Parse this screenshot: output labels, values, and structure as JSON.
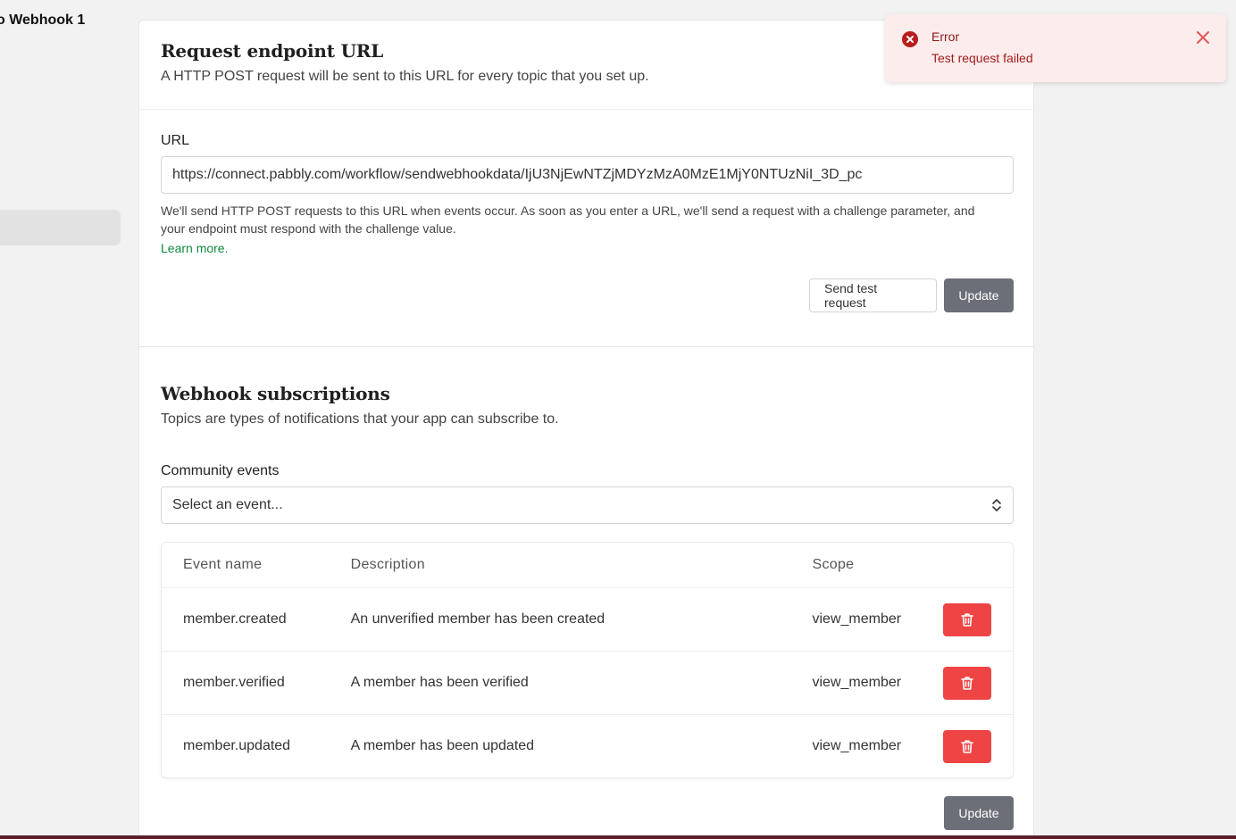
{
  "page_title": "o Webhook 1",
  "endpoint": {
    "heading": "Request endpoint URL",
    "subtitle": "A HTTP POST request will be sent to this URL for every topic that you set up.",
    "url_label": "URL",
    "url_value": "https://connect.pabbly.com/workflow/sendwebhookdata/IjU3NjEwNTZjMDYzMzA0MzE1MjY0NTUzNiI_3D_pc",
    "help_text": "We'll send HTTP POST requests to this URL when events occur. As soon as you enter a URL, we'll send a request with a challenge parameter, and your endpoint must respond with the challenge value.",
    "learn_more": "Learn more.",
    "send_test_label": "Send test request",
    "update_label": "Update"
  },
  "subscriptions": {
    "heading": "Webhook subscriptions",
    "subtitle": "Topics are types of notifications that your app can subscribe to.",
    "select_label": "Community events",
    "select_placeholder": "Select an event...",
    "columns": [
      "Event name",
      "Description",
      "Scope"
    ],
    "rows": [
      {
        "event": "member.created",
        "description": "An unverified member has been created",
        "scope": "view_member"
      },
      {
        "event": "member.verified",
        "description": "A member has been verified",
        "scope": "view_member"
      },
      {
        "event": "member.updated",
        "description": "A member has been updated",
        "scope": "view_member"
      }
    ],
    "update_label": "Update"
  },
  "toast": {
    "title": "Error",
    "message": "Test request failed",
    "icon": "error-circle-icon"
  },
  "colors": {
    "danger": "#ef4444",
    "link": "#0f8a3e",
    "primary_gray": "#6c6f78",
    "toast_bg": "#fdecec"
  }
}
